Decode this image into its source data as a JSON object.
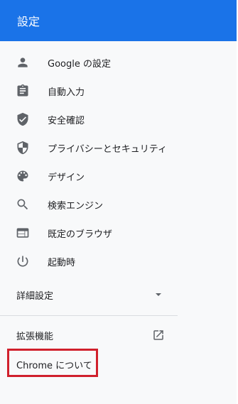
{
  "header": {
    "title": "設定"
  },
  "nav": {
    "items": [
      {
        "label": "Google の設定",
        "icon": "person-icon"
      },
      {
        "label": "自動入力",
        "icon": "clipboard-icon"
      },
      {
        "label": "安全確認",
        "icon": "shield-check-icon"
      },
      {
        "label": "プライバシーとセキュリティ",
        "icon": "security-shield-icon"
      },
      {
        "label": "デザイン",
        "icon": "palette-icon"
      },
      {
        "label": "検索エンジン",
        "icon": "search-icon"
      },
      {
        "label": "既定のブラウザ",
        "icon": "browser-window-icon"
      },
      {
        "label": "起動時",
        "icon": "power-icon"
      }
    ]
  },
  "advanced": {
    "label": "詳細設定",
    "icon": "caret-down-icon"
  },
  "extensions": {
    "label": "拡張機能",
    "icon": "open-in-new-icon"
  },
  "about": {
    "label": "Chrome について"
  },
  "colors": {
    "header_bg": "#1a73e8",
    "panel_bg": "#f8f9fa",
    "highlight_border": "#d0202c"
  }
}
